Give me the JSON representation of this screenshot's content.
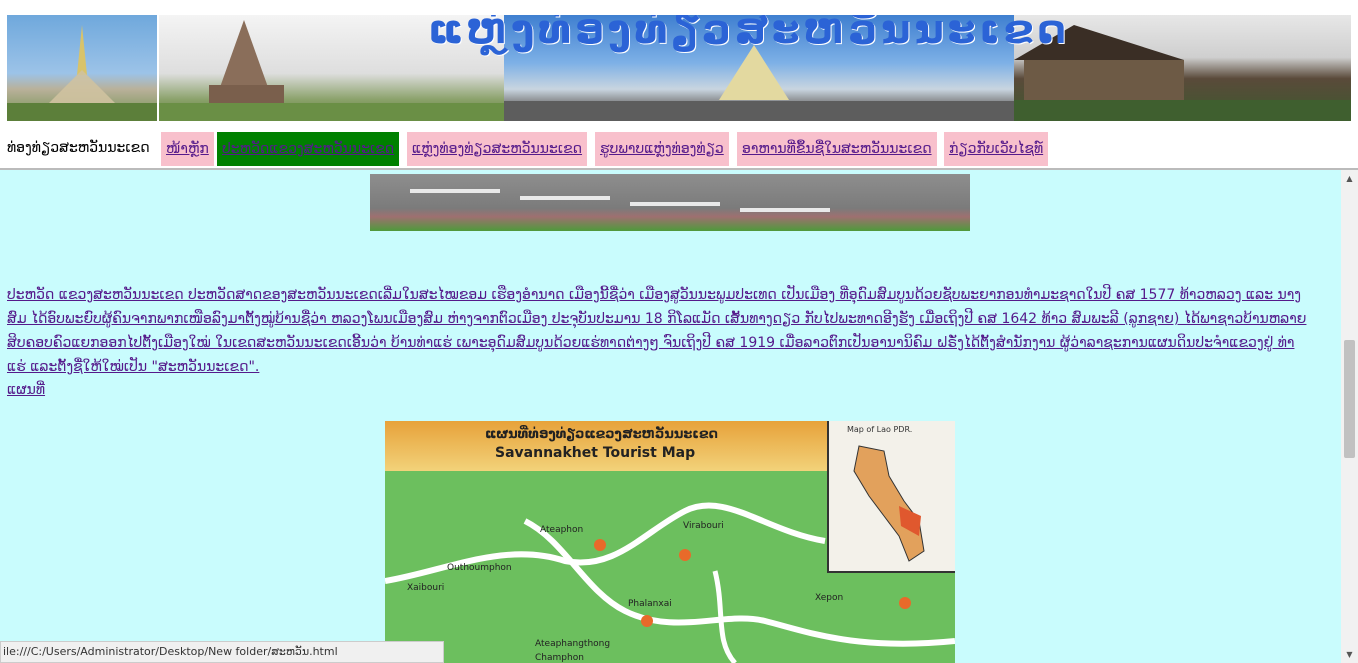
{
  "header": {
    "banner_title": "ແຫຼ່ງທ່ອງທ່ຽວສະຫວັນນະເຂດ"
  },
  "nav": {
    "label": "ທ່ອງທ່ຽວສະຫວັນນະເຂດ",
    "items": [
      {
        "label": "ໜ້າຫຼັກ"
      },
      {
        "label": "ປະຫວັດແຂວງສະຫວັນນະເຂດ",
        "active": true
      },
      {
        "label": "ແຫຼ່ງທ່ອງທ່ຽວສະຫວັນນະເຂດ"
      },
      {
        "label": "ຮູບພາບແຫຼ່ງທ່ອງທ່ຽວ"
      },
      {
        "label": "ອາຫານທີ່ຂຶ້ນຊື່ໃນສະຫວັນນະເຂດ"
      },
      {
        "label": "ກ່ຽວກັບເວັບໄຊທ໌"
      }
    ]
  },
  "content": {
    "paragraph": "ປະຫວັດ ແຂວງສະຫວັນນະເຂດ ປະຫວັດສາດຂອງສະຫວັນນະເຂດເລີ່ມໃນສະໄໝຂອມ ເຮືອງອຳນາດ ເມືອງນີ້ຊື່ວ່າ ເມືອງສູວັນນະພູມປະເທດ ເປັນເມືອງ ທີ່ອຸດົມສົມບູນດ້ວຍຊັບພະຍາກອນທຳມະຊາດໃນປີ ຄສ 1577 ທ້າວຫລວງ ແລະ ນາງສົມ ໄດ້ອົບພະຍົບຜູ້ຄົນຈາກພາກເໜືອລົງມາຕັ້ງໝູ່ບ້ານຊື່ວ່າ ຫລວງໂພນເມືອງສົມ ຫ່າງຈາກຕົວເມືອງ ປະຈຸບັນປະມານ 18 ກິໂລແມັດ ເສັ້ນທາງດຽວ ກັບໄປພະທາດອີງຮັງ ເມື່ອເຖິງປີ ຄສ 1642 ທ້າວ ສົມພະລີ (ລູກຊາຍ) ໄດ້ພາຊາວບ້ານຫລາຍສິບຄອບຄົວແຍກອອກໄປຕັ້ງເມືອງໃໝ່ ໃນເຂດສະຫວັນນະເຂດເອີ້ນວ່າ ບ້ານທ່າແຮ່ ເພາະອຸດົມສົມບູນດ້ວຍແຮ່ທາດຕ່າງໆ ຈົນເຖິງປີ ຄສ 1919 ເມື່ອລາວຕົກເປັນອານານິຄົມ ຝຣັ່ງໄດ້ຕັ້ງສຳນັກງານ ຜູ້ວ່າລາຊະການແຜນດິນປະຈຳແຂວງຢູ່ ທ່າແຮ່ ແລະຕັ້ງຊື່ໃຫ້ໃໝ່ເປັນ \"ສະຫວັນນະເຂດ\".",
    "map_label": "ແຜນທີ່",
    "map": {
      "title_lao": "ແຜນທີ່ທ່ອງທ່ຽວແຂວງສະຫວັນນະເຂດ",
      "title_en": "Savannakhet Tourist Map",
      "inset_title": "Map of Lao PDR.",
      "places": [
        "Ateaphon",
        "Virabouri",
        "Xaibouri",
        "Outhoumphon",
        "Phalanxai",
        "Xepon",
        "Ateaphangthong",
        "Champhon"
      ]
    }
  },
  "status_bar": {
    "url": "ile:///C:/Users/Administrator/Desktop/New folder/ສະຫວັນ.html"
  }
}
